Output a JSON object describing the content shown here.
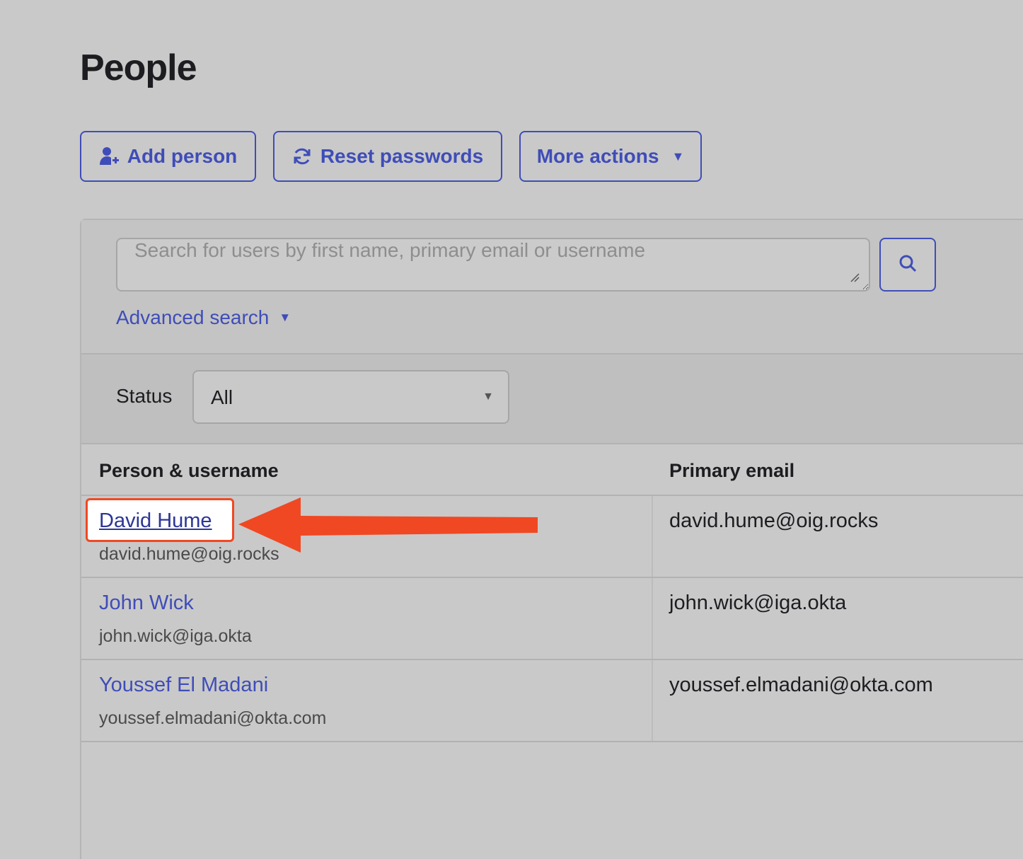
{
  "page": {
    "title": "People"
  },
  "toolbar": {
    "add_person": "Add person",
    "reset_passwords": "Reset passwords",
    "more_actions": "More actions"
  },
  "search": {
    "placeholder": "Search for users by first name, primary email or username",
    "value": "",
    "advanced_label": "Advanced search"
  },
  "filters": {
    "status_label": "Status",
    "status_value": "All"
  },
  "table": {
    "headers": [
      "Person & username",
      "Primary email"
    ],
    "rows": [
      {
        "name": "David Hume",
        "username": "david.hume@oig.rocks",
        "email": "david.hume@oig.rocks"
      },
      {
        "name": "John Wick",
        "username": "john.wick@iga.okta",
        "email": "john.wick@iga.okta"
      },
      {
        "name": "Youssef El Madani",
        "username": "youssef.elmadani@okta.com",
        "email": "youssef.elmadani@okta.com"
      }
    ]
  },
  "colors": {
    "accent": "#3f4db8",
    "annotation": "#f04823",
    "background": "#c9c9c9"
  },
  "icons": [
    "add-person-icon",
    "refresh-icon",
    "chevron-down-icon",
    "search-icon",
    "resize-grip-icon",
    "annotation-arrow"
  ]
}
